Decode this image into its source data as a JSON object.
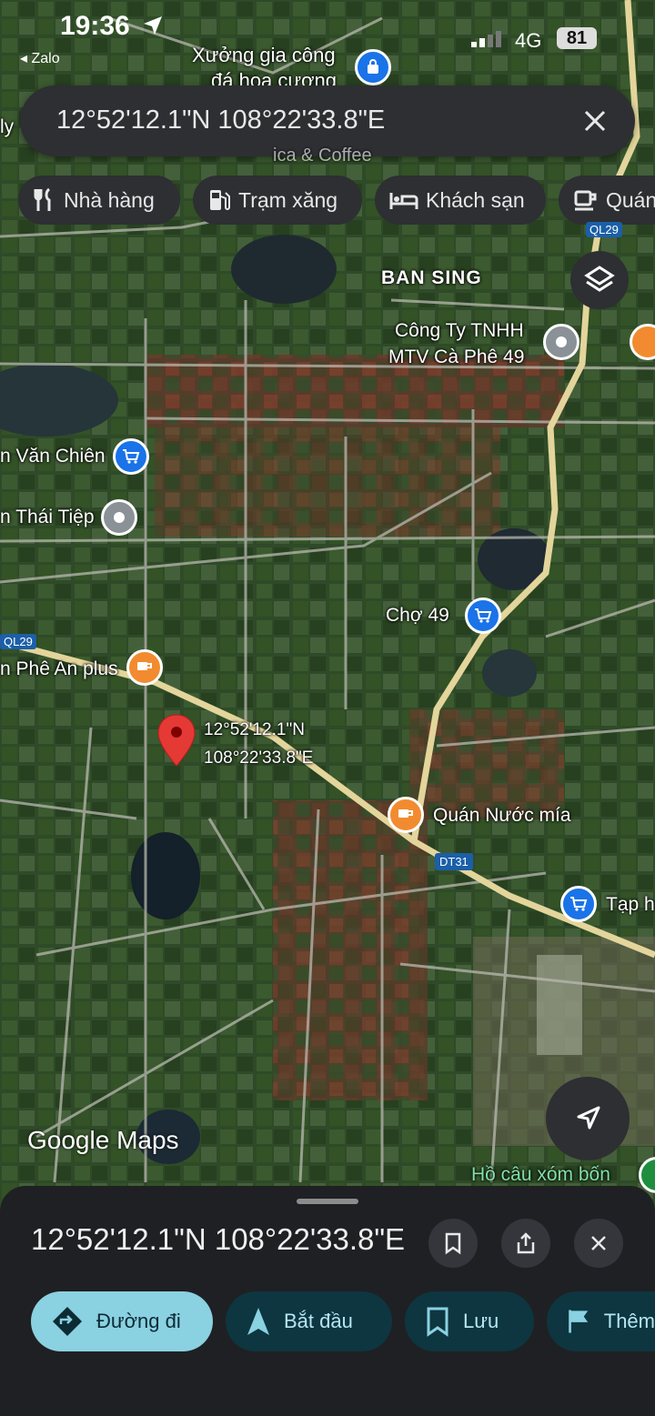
{
  "status_bar": {
    "time": "19:36",
    "back_app": "Zalo",
    "network": "4G",
    "battery": "81"
  },
  "search": {
    "value": "12°52'12.1\"N 108°22'33.8\"E"
  },
  "chips": [
    {
      "label": "Nhà hàng",
      "icon": "restaurant-icon"
    },
    {
      "label": "Trạm xăng",
      "icon": "gas-station-icon"
    },
    {
      "label": "Khách sạn",
      "icon": "hotel-icon"
    },
    {
      "label": "Quán",
      "icon": "cafe-icon"
    }
  ],
  "map_labels": {
    "xuong": "Xưởng gia công",
    "xuong2": "đá hoa cương",
    "ly": "ly",
    "coffee_cut": "ica & Coffee",
    "ql29_top": "QL29",
    "ban_sing": "BAN SING",
    "congty1": "Công Ty TNHH",
    "congty2": "MTV Cà Phê 49",
    "van_chien": "n Văn Chiên",
    "thai_tiep": "n Thái Tiệp",
    "cho49": "Chợ 49",
    "ql29_left": "QL29",
    "an_plus": "n Phê An plus",
    "pin_line1": "12°52'12.1\"N",
    "pin_line2": "108°22'33.8\"E",
    "nuoc_mia": "Quán Nước mía",
    "dt31": "DT31",
    "tap_hoa": "Tạp h",
    "ho_cau": "Hồ câu xóm bốn"
  },
  "brand": "Google Maps",
  "sheet": {
    "title": "12°52'12.1\"N 108°22'33.8\"E",
    "actions": [
      {
        "label": "Đường đi",
        "icon": "directions-icon"
      },
      {
        "label": "Bắt đầu",
        "icon": "navigation-arrow-icon"
      },
      {
        "label": "Lưu",
        "icon": "bookmark-icon"
      },
      {
        "label": "Thêm",
        "icon": "flag-icon"
      }
    ]
  },
  "colors": {
    "accent": "#8ad1e2",
    "dark_chip": "#2d2f33",
    "sheet_bg": "#1f2023",
    "pin_red": "#e53935",
    "shop_blue": "#1a73e8",
    "food_orange": "#f28b30",
    "road_yellow": "#e8d89a"
  }
}
